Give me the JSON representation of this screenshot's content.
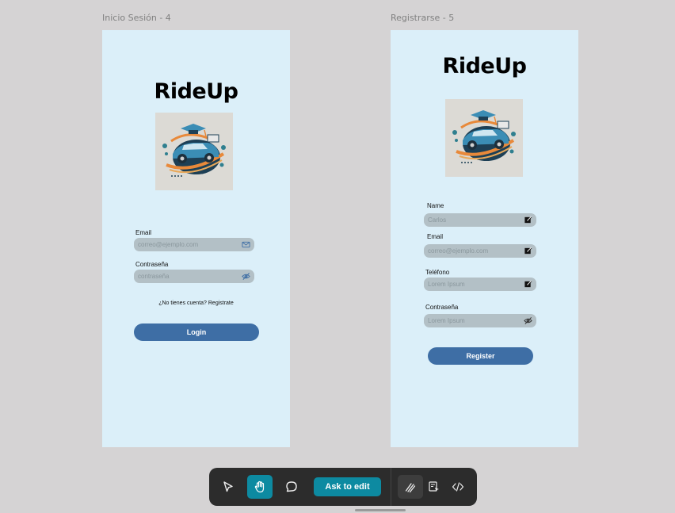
{
  "frames": {
    "login": {
      "label": "Inicio Sesión - 4",
      "title": "RideUp",
      "email_label": "Email",
      "email_placeholder": "correo@ejemplo.com",
      "password_label": "Contraseña",
      "password_placeholder": "contraseña",
      "register_link": "¿No tienes cuenta? Registrate",
      "login_button": "Login",
      "email_icon": "mail-icon",
      "password_icon": "eye-off-icon"
    },
    "register": {
      "label": "Registrarse - 5",
      "title": "RideUp",
      "name_label": "Name",
      "name_placeholder": "Carlos",
      "email_label": "Email",
      "email_placeholder": "correo@ejemplo.com",
      "phone_label": "Teléfono",
      "phone_placeholder": "Lorem Ipsum",
      "password_label": "Contraseña",
      "password_placeholder": "Lorem Ipsum",
      "register_button": "Register",
      "edit_icon": "edit-icon",
      "password_icon": "eye-off-icon"
    }
  },
  "toolbar": {
    "tools": [
      "move-tool",
      "hand-tool",
      "comment-tool"
    ],
    "active_tool": "hand-tool",
    "ask_to_edit": "Ask to edit",
    "modes": [
      "design-mode",
      "dev-mode",
      "code-mode"
    ],
    "active_mode": "design-mode"
  },
  "colors": {
    "canvas": "#d5d3d4",
    "frame": "#dbeff9",
    "field": "#b3c0c6",
    "button": "#3e6ea5",
    "toolbar": "#2c2c2c",
    "accent": "#0d8aa1"
  }
}
